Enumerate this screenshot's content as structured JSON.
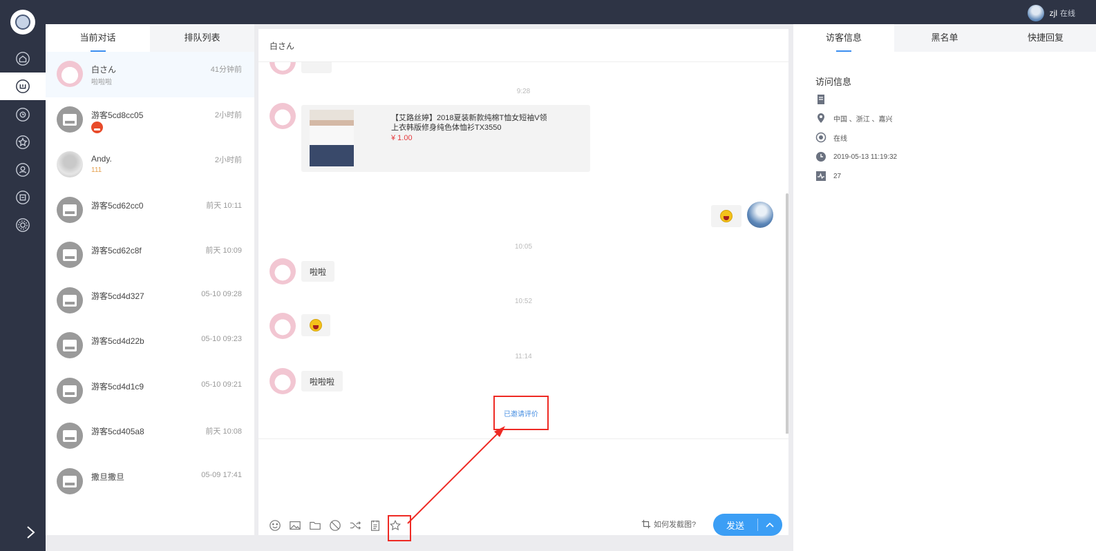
{
  "topbar": {
    "user_name": "zjl",
    "user_status": "在线"
  },
  "sidebar": {
    "items": [
      {
        "icon": "home-icon"
      },
      {
        "icon": "chat-icon"
      },
      {
        "icon": "history-icon"
      },
      {
        "icon": "star-icon"
      },
      {
        "icon": "user-icon"
      },
      {
        "icon": "store-icon"
      },
      {
        "icon": "settings-icon"
      }
    ],
    "active_index": 1
  },
  "conversation_panel": {
    "tabs": [
      "当前对话",
      "排队列表"
    ],
    "active_tab": 0,
    "conversations": [
      {
        "name": "白さん",
        "time": "41分钟前",
        "preview": "啦啦啦",
        "avatar": "girl",
        "active": true
      },
      {
        "name": "游客5cd8cc05",
        "time": "2小时前",
        "preview": "",
        "avatar": "robot",
        "emoji": "angry-emoji-icon"
      },
      {
        "name": "Andy.",
        "time": "2小时前",
        "preview": "111",
        "avatar": "photo"
      },
      {
        "name": "游客5cd62cc0",
        "time": "前天 10:11",
        "preview": "",
        "avatar": "robot"
      },
      {
        "name": "游客5cd62c8f",
        "time": "前天 10:09",
        "preview": "",
        "avatar": "robot"
      },
      {
        "name": "游客5cd4d327",
        "time": "05-10 09:28",
        "preview": "",
        "avatar": "robot"
      },
      {
        "name": "游客5cd4d22b",
        "time": "05-10 09:23",
        "preview": "",
        "avatar": "robot"
      },
      {
        "name": "游客5cd4d1c9",
        "time": "05-10 09:21",
        "preview": "",
        "avatar": "robot"
      },
      {
        "name": "游客5cd405a8",
        "time": "前天 10:08",
        "preview": "",
        "avatar": "robot"
      },
      {
        "name": "撒旦撒旦",
        "time": "05-09 17:41",
        "preview": "",
        "avatar": "robot"
      }
    ]
  },
  "chat": {
    "title": "白さん",
    "timestamps": [
      "9:28",
      "10:05",
      "10:52",
      "11:14"
    ],
    "product": {
      "title": "【艾路丝婷】2018夏装新款纯棉T恤女短袖V领上衣韩版修身纯色体恤衫TX3550",
      "price": "¥ 1.00"
    },
    "messages": [
      {
        "from": "visitor",
        "text": "啦啦"
      },
      {
        "from": "visitor",
        "emoji": "laugh-emoji-icon"
      },
      {
        "from": "visitor",
        "text": "啦啦啦"
      }
    ],
    "invite_text": "已邀请评价",
    "toolbar": [
      "smile-icon",
      "image-icon",
      "folder-icon",
      "block-icon",
      "transfer-icon",
      "note-icon",
      "star-rating-icon"
    ],
    "crop_hint": "如何发截图?",
    "send_label": "发送"
  },
  "right_panel": {
    "tabs": [
      "访客信息",
      "黑名单",
      "快捷回复"
    ],
    "active_tab": 0,
    "info_title": "访问信息",
    "rows": [
      {
        "icon": "document-icon",
        "text": ""
      },
      {
        "icon": "location-icon",
        "text": "中国 、浙江 、嘉兴"
      },
      {
        "icon": "online-icon",
        "text": "在线"
      },
      {
        "icon": "clock-icon",
        "text": "2019-05-13 11:19:32"
      },
      {
        "icon": "activity-icon",
        "text": "27"
      }
    ]
  },
  "colors": {
    "accent": "#3b9ef5",
    "rail": "#2e3445",
    "highlight": "#ee2a24"
  }
}
